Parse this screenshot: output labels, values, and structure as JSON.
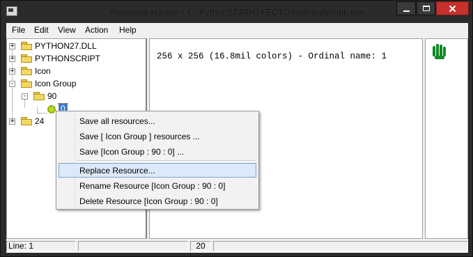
{
  "window": {
    "title": "Resource Hacker  -  C:\\Python27\\PROYECTO\\hulk\\hulk\\hulk.exe",
    "controls": {
      "minimize": "minimize",
      "maximize": "maximize",
      "close": "✕"
    }
  },
  "menu": [
    "File",
    "Edit",
    "View",
    "Action",
    "Help"
  ],
  "tree": {
    "items": [
      {
        "label": "PYTHON27.DLL",
        "expander": "+"
      },
      {
        "label": "PYTHONSCRIPT",
        "expander": "+"
      },
      {
        "label": "Icon",
        "expander": "+"
      },
      {
        "label": "Icon Group",
        "expander": "-"
      },
      {
        "label": "90",
        "expander": "-"
      },
      {
        "label": "0"
      },
      {
        "label": "24",
        "expander": "+"
      }
    ]
  },
  "main": {
    "info_text": "256 x 256 (16.8mil colors) - Ordinal name: 1"
  },
  "context_menu": {
    "items": [
      "Save all resources...",
      "Save [ Icon Group ] resources ...",
      "Save [Icon Group : 90 : 0] ...",
      "Replace Resource...",
      "Rename Resource [Icon Group : 90 : 0]",
      "Delete Resource [Icon Group : 90 : 0]"
    ],
    "highlighted_index": 3
  },
  "status": {
    "line": "Line: 1",
    "field2": "",
    "count": "20",
    "field4": ""
  },
  "colors": {
    "titlebar": "#2b2b2b",
    "close_button": "#c7302b",
    "selection": "#3a7bd5",
    "menu_hover": "#dbe9f8",
    "icon_green": "#0f8a25"
  }
}
